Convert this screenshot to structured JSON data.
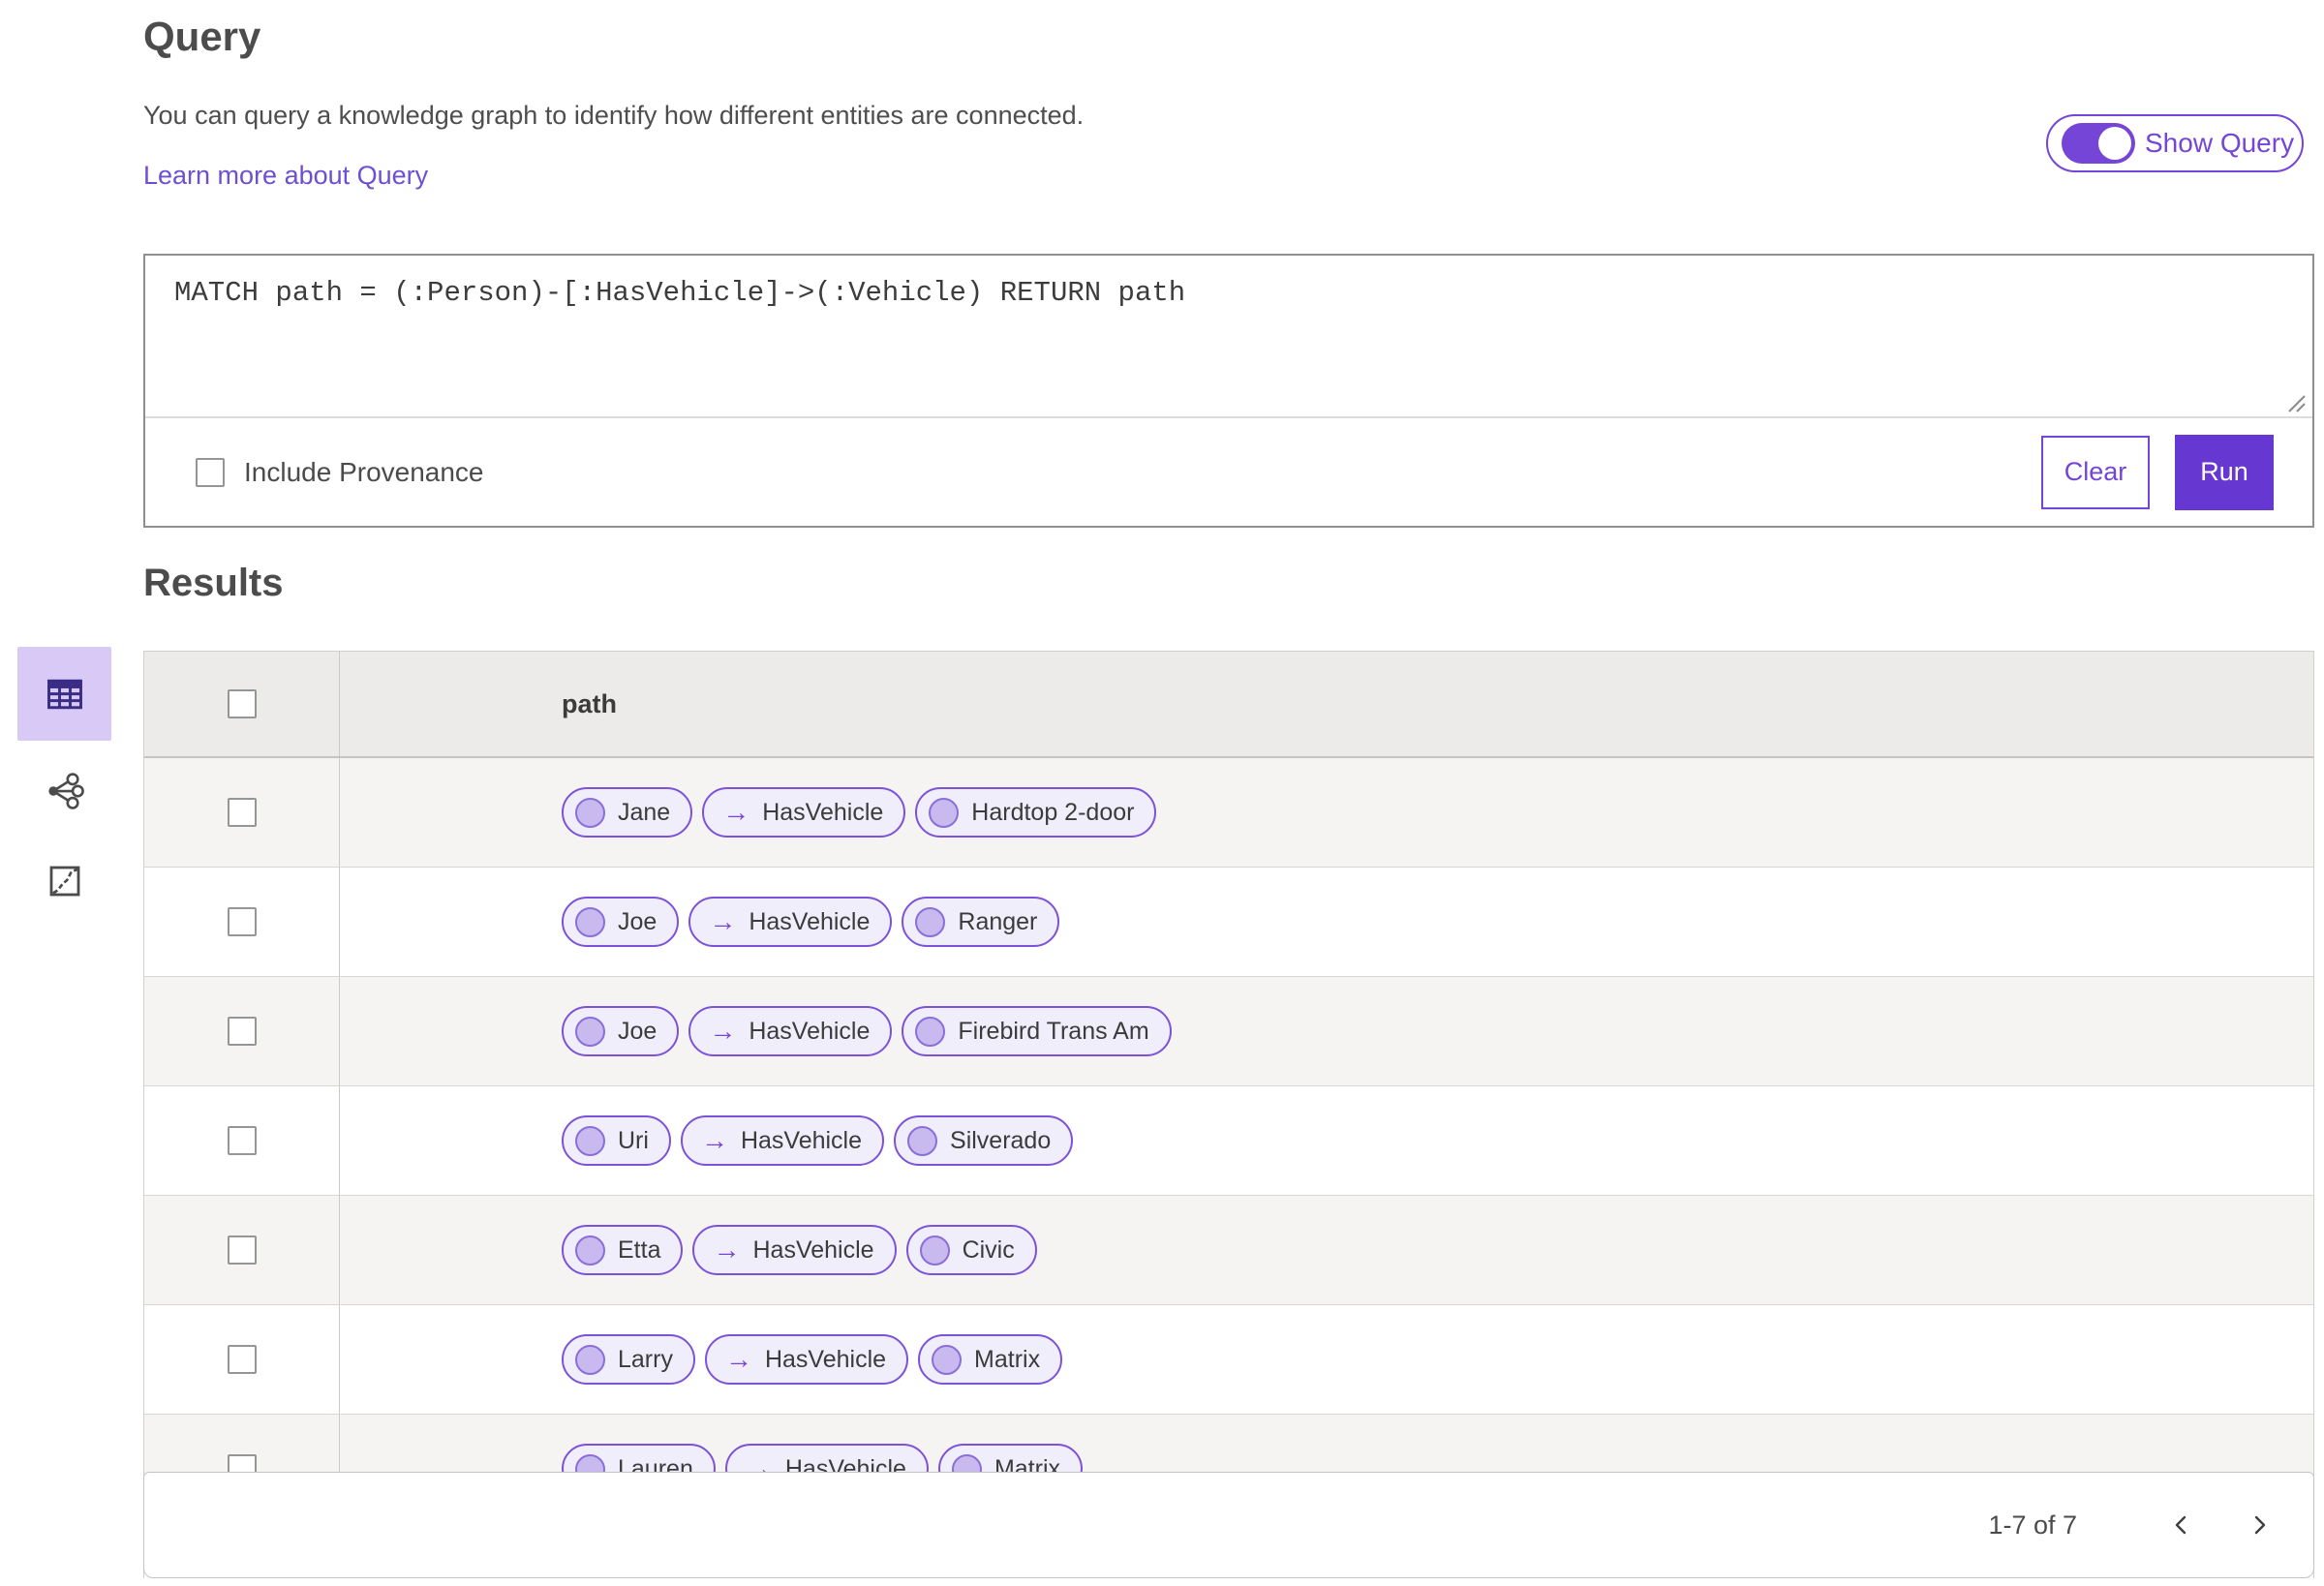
{
  "colors": {
    "accent": "#7445D6",
    "run_bg": "#6737D2",
    "link": "#6E4FD1",
    "selected_view_bg": "#D8C9F6",
    "pill_bg": "#F1EEFB",
    "pill_border": "#7C52D9",
    "circle_fill": "#C8BAEE",
    "circle_border": "#8A6ED9",
    "header_bg": "#EDEBE9",
    "row_alt_bg": "#F5F4F2",
    "icon_dark": "#3A2D86"
  },
  "query": {
    "title": "Query",
    "description": "You can query a knowledge graph to identify how different entities are connected.",
    "learn_more_label": "Learn more about Query",
    "show_query_label": "Show Query",
    "show_query_on": true,
    "query_text": "MATCH path = (:Person)-[:HasVehicle]->(:Vehicle) RETURN path",
    "include_provenance_label": "Include Provenance",
    "include_provenance_checked": false,
    "clear_label": "Clear",
    "run_label": "Run"
  },
  "results": {
    "title": "Results",
    "views": [
      {
        "id": "table",
        "icon": "table-grid-icon",
        "selected": true
      },
      {
        "id": "link-chart",
        "icon": "link-chart-icon",
        "selected": false
      },
      {
        "id": "map",
        "icon": "map-icon",
        "selected": false
      }
    ],
    "table": {
      "column_header": "path",
      "rows": [
        {
          "pills": [
            {
              "kind": "entity",
              "label": "Jane"
            },
            {
              "kind": "relationship",
              "label": "HasVehicle"
            },
            {
              "kind": "entity",
              "label": "Hardtop 2-door"
            }
          ]
        },
        {
          "pills": [
            {
              "kind": "entity",
              "label": "Joe"
            },
            {
              "kind": "relationship",
              "label": "HasVehicle"
            },
            {
              "kind": "entity",
              "label": "Ranger"
            }
          ]
        },
        {
          "pills": [
            {
              "kind": "entity",
              "label": "Joe"
            },
            {
              "kind": "relationship",
              "label": "HasVehicle"
            },
            {
              "kind": "entity",
              "label": "Firebird Trans Am"
            }
          ]
        },
        {
          "pills": [
            {
              "kind": "entity",
              "label": "Uri"
            },
            {
              "kind": "relationship",
              "label": "HasVehicle"
            },
            {
              "kind": "entity",
              "label": "Silverado"
            }
          ]
        },
        {
          "pills": [
            {
              "kind": "entity",
              "label": "Etta"
            },
            {
              "kind": "relationship",
              "label": "HasVehicle"
            },
            {
              "kind": "entity",
              "label": "Civic"
            }
          ]
        },
        {
          "pills": [
            {
              "kind": "entity",
              "label": "Larry"
            },
            {
              "kind": "relationship",
              "label": "HasVehicle"
            },
            {
              "kind": "entity",
              "label": "Matrix"
            }
          ]
        },
        {
          "pills": [
            {
              "kind": "entity",
              "label": "Lauren"
            },
            {
              "kind": "relationship",
              "label": "HasVehicle"
            },
            {
              "kind": "entity",
              "label": "Matrix"
            }
          ]
        }
      ]
    },
    "pagination": {
      "range_label": "1-7 of 7",
      "prev_icon": "chevron-left-icon",
      "next_icon": "chevron-right-icon"
    }
  }
}
